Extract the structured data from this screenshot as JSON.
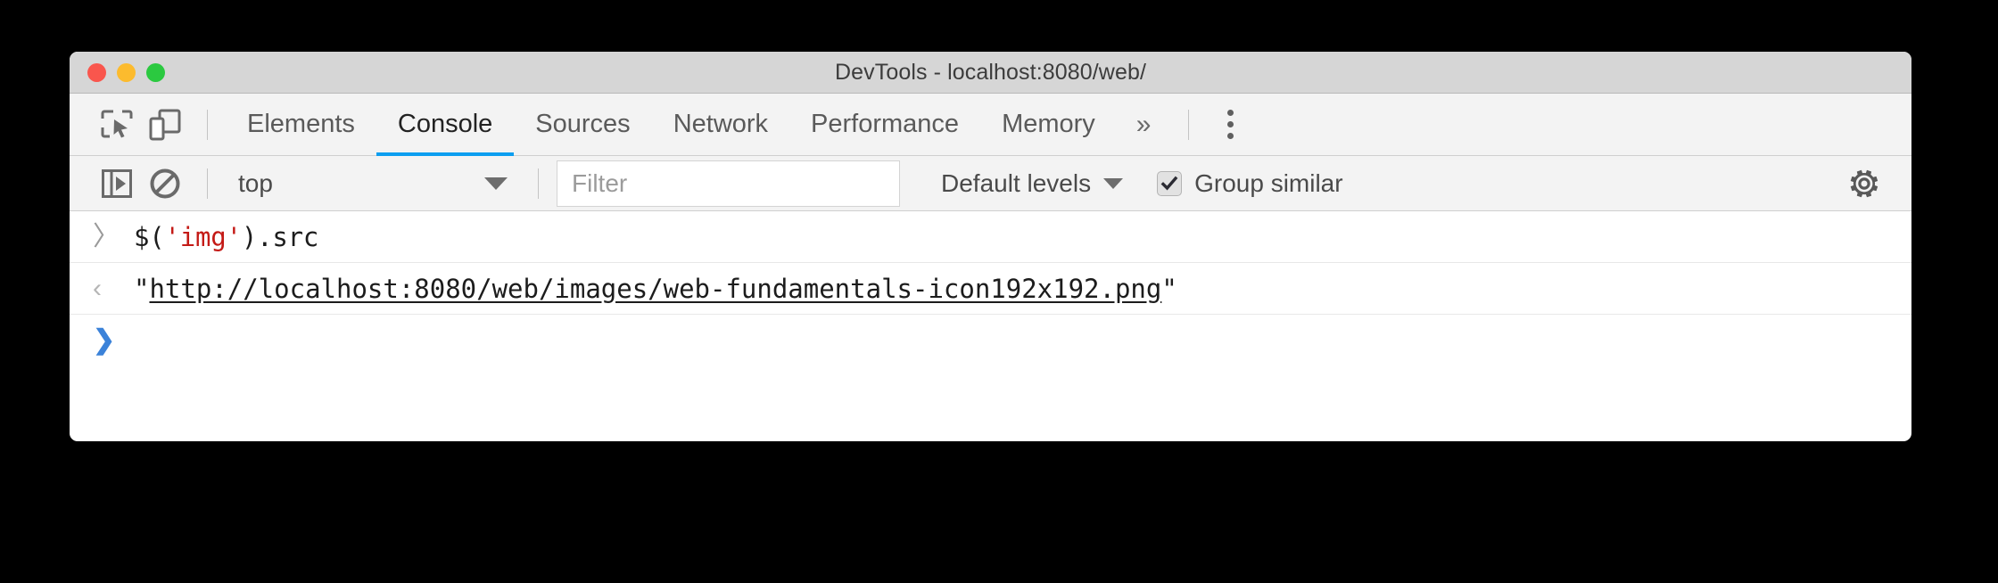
{
  "window": {
    "title": "DevTools - localhost:8080/web/",
    "traffic_lights": [
      {
        "name": "close",
        "color": "#f9564d"
      },
      {
        "name": "minimize",
        "color": "#fcbb2e"
      },
      {
        "name": "zoom",
        "color": "#2bc940"
      }
    ]
  },
  "tabbar": {
    "inspect_icon": "inspect-element-icon",
    "device_icon": "device-toolbar-icon",
    "tabs": [
      {
        "label": "Elements",
        "active": false
      },
      {
        "label": "Console",
        "active": true
      },
      {
        "label": "Sources",
        "active": false
      },
      {
        "label": "Network",
        "active": false
      },
      {
        "label": "Performance",
        "active": false
      },
      {
        "label": "Memory",
        "active": false
      }
    ],
    "overflow_label": "»",
    "more_options_icon": "kebab-menu-icon",
    "active_underline_color": "#0c9ef0"
  },
  "console_toolbar": {
    "sidebar_toggle_icon": "console-sidebar-toggle-icon",
    "clear_icon": "clear-console-icon",
    "context": {
      "value": "top",
      "caret": "chevron-down-icon"
    },
    "filter": {
      "placeholder": "Filter",
      "value": ""
    },
    "levels": {
      "label": "Default levels",
      "caret": "chevron-down-icon"
    },
    "group_similar": {
      "label": "Group similar",
      "checked": true,
      "check_glyph": "✔"
    },
    "settings_icon": "gear-icon"
  },
  "console": {
    "rows": [
      {
        "type": "input",
        "marker": "〉",
        "expression_parts": [
          {
            "text": "$(",
            "kind": "plain"
          },
          {
            "text": "'img'",
            "kind": "string"
          },
          {
            "text": ").src",
            "kind": "plain"
          }
        ]
      },
      {
        "type": "output",
        "marker": "‹",
        "quote_open": "\"",
        "url": "http://localhost:8080/web/images/web-fundamentals-icon192x192.png",
        "quote_close": "\""
      },
      {
        "type": "prompt",
        "marker": "❯",
        "value": ""
      }
    ]
  },
  "colors": {
    "accent": "#0c9ef0",
    "string_literal": "#c41a16",
    "prompt": "#3b82d9",
    "titlebar_bg": "#d6d6d6",
    "toolbar_bg": "#f3f3f3",
    "page_bg": "#000000"
  }
}
